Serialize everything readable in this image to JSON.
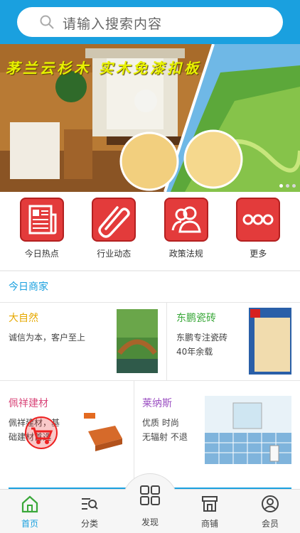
{
  "search": {
    "placeholder": "请输入搜索内容"
  },
  "banner": {
    "caption": "茅兰云杉木 实木免漆扣板",
    "dots": 3,
    "active_dot": 0
  },
  "quick_menu": [
    {
      "label": "今日热点",
      "icon": "newspaper-icon"
    },
    {
      "label": "行业动态",
      "icon": "paperclip-icon"
    },
    {
      "label": "政策法规",
      "icon": "users-icon"
    },
    {
      "label": "更多",
      "icon": "more-dots-icon"
    }
  ],
  "section": {
    "title": "今日商家"
  },
  "merchants": [
    {
      "name": "大自然",
      "name_color": "#e6a800",
      "desc": "诚信为本，客户至上"
    },
    {
      "name": "东鹏瓷砖",
      "name_color": "#3aa83a",
      "desc_line1": "东鹏专注瓷砖",
      "desc_line2": "40年余载"
    },
    {
      "name": "佩祥建材",
      "name_color": "#d9477a",
      "desc_line1": "佩祥建材，基",
      "desc_line2": "础建材首选"
    },
    {
      "name": "莱纳斯",
      "name_color": "#9b4fc2",
      "desc_line1": "优质 时尚",
      "desc_line2": "无辐射 不退"
    }
  ],
  "tabbar": [
    {
      "label": "首页",
      "icon": "home-icon",
      "active": true
    },
    {
      "label": "分类",
      "icon": "category-search-icon",
      "active": false
    },
    {
      "label": "发现",
      "icon": "grid-icon",
      "active": false
    },
    {
      "label": "商铺",
      "icon": "shop-icon",
      "active": false
    },
    {
      "label": "会员",
      "icon": "user-icon",
      "active": false
    }
  ],
  "colors": {
    "brand": "#1aa0df",
    "icon_red": "#e33b3b"
  }
}
